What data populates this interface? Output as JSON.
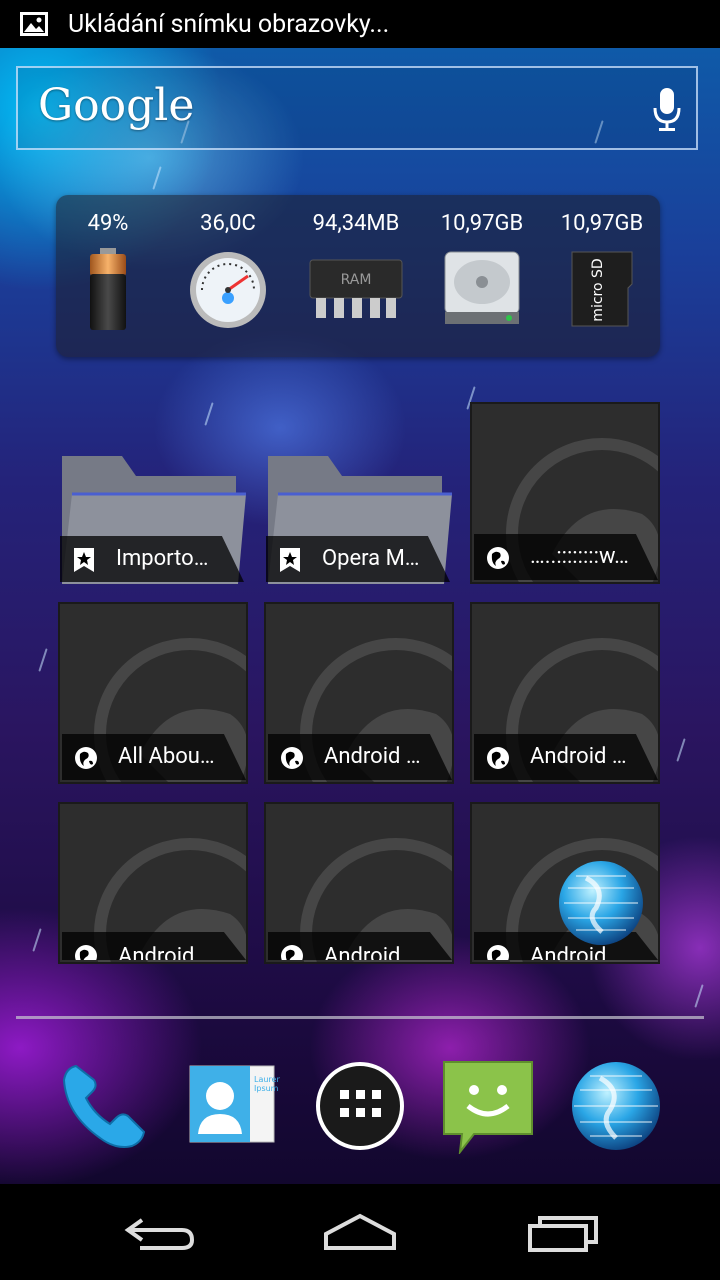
{
  "status_bar": {
    "notification_icon": "image-icon",
    "notification_text": "Ukládání snímku obrazovky..."
  },
  "search_widget": {
    "logo_text": "Google",
    "mic_icon": "microphone-icon"
  },
  "system_widget": {
    "items": [
      {
        "label": "49%",
        "icon": "battery-icon"
      },
      {
        "label": "36,0C",
        "icon": "temperature-gauge-icon"
      },
      {
        "label": "94,34MB",
        "icon": "ram-chip-icon"
      },
      {
        "label": "10,97GB",
        "icon": "hard-drive-icon"
      },
      {
        "label": "10,97GB",
        "icon": "microsd-card-icon"
      }
    ]
  },
  "bookmarks": [
    {
      "label": "Importo…",
      "type": "folder",
      "icon": "bookmark-folder-icon"
    },
    {
      "label": "Opera M…",
      "type": "folder",
      "icon": "bookmark-folder-icon"
    },
    {
      "label": "…..::::::::w…",
      "type": "page",
      "icon": "globe-icon"
    },
    {
      "label": "All Abou…",
      "type": "page",
      "icon": "globe-icon"
    },
    {
      "label": "Android …",
      "type": "page",
      "icon": "globe-icon"
    },
    {
      "label": "Android …",
      "type": "page",
      "icon": "globe-icon"
    },
    {
      "label": "Android",
      "type": "page",
      "icon": "globe-icon"
    },
    {
      "label": "Android",
      "type": "page",
      "icon": "globe-icon"
    },
    {
      "label": "Android",
      "type": "page",
      "icon": "globe-icon"
    }
  ],
  "dock": [
    "phone-icon",
    "contacts-icon",
    "app-drawer-icon",
    "messaging-icon",
    "browser-globe-icon"
  ],
  "contacts_card_text": "Lauren Ipsum",
  "nav": [
    "back-icon",
    "home-icon",
    "recent-apps-icon"
  ],
  "colors": {
    "accent": "#33b5e5",
    "status_bg": "#000000",
    "caption_bg": "#000000"
  }
}
